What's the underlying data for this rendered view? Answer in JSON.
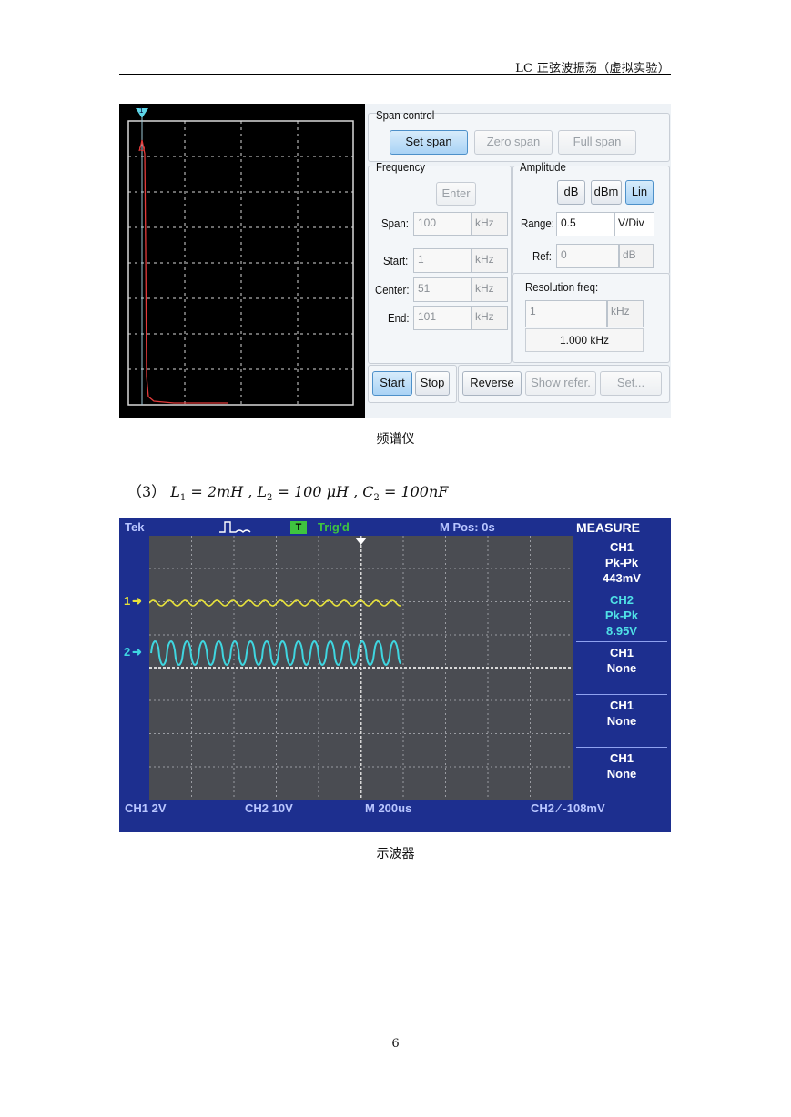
{
  "header": {
    "title": "LC 正弦波振荡（虚拟实验）"
  },
  "spectrum": {
    "marker_label": "1",
    "span_control": {
      "title": "Span control",
      "set_span": "Set span",
      "zero_span": "Zero span",
      "full_span": "Full span"
    },
    "frequency": {
      "title": "Frequency",
      "enter": "Enter",
      "span_label": "Span:",
      "span_value": "100",
      "span_unit": "kHz",
      "start_label": "Start:",
      "start_value": "1",
      "start_unit": "kHz",
      "center_label": "Center:",
      "center_value": "51",
      "center_unit": "kHz",
      "end_label": "End:",
      "end_value": "101",
      "end_unit": "kHz"
    },
    "amplitude": {
      "title": "Amplitude",
      "db": "dB",
      "dbm": "dBm",
      "lin": "Lin",
      "range_label": "Range:",
      "range_value": "0.5",
      "range_unit": "V/Div",
      "ref_label": "Ref:",
      "ref_value": "0",
      "ref_unit": "dB"
    },
    "resolution": {
      "title": "Resolution freq:",
      "value": "1",
      "unit": "kHz",
      "readout": "1.000 kHz"
    },
    "buttons": {
      "start": "Start",
      "stop": "Stop",
      "reverse": "Reverse",
      "show_refer": "Show refer.",
      "set": "Set..."
    },
    "caption": "频谱仪"
  },
  "equation": {
    "prefix": "（3）",
    "L1": "L",
    "L1_sub": "1",
    "L1_val": " = 2mH , ",
    "L2": "L",
    "L2_sub": "2",
    "L2_val": " = 100 μH , ",
    "C2": "C",
    "C2_sub": "2",
    "C2_val": " = 100nF"
  },
  "scope": {
    "brand": "Tek",
    "trig_badge": "T",
    "trig_status": "Trig'd",
    "mpos": "M Pos: 0s",
    "measure_title": "MEASURE",
    "measures": [
      {
        "ch": "CH1",
        "type": "Pk-Pk",
        "value": "443mV",
        "color": "#ffffff"
      },
      {
        "ch": "CH2",
        "type": "Pk-Pk",
        "value": "8.95V",
        "color": "#4fe0e6"
      },
      {
        "ch": "CH1",
        "type": "None",
        "value": "",
        "color": "#ffffff"
      },
      {
        "ch": "CH1",
        "type": "None",
        "value": "",
        "color": "#ffffff"
      },
      {
        "ch": "CH1",
        "type": "None",
        "value": "",
        "color": "#ffffff"
      }
    ],
    "ch1_marker": "1",
    "ch2_marker": "2",
    "ch1_scale": "CH1  2V",
    "ch2_scale": "CH2  10V",
    "timebase": "M 200us",
    "trigger": "CH2 ∕ -108mV",
    "ch1_color": "#e8e23a",
    "ch2_color": "#3fd6e0",
    "caption": "示波器"
  },
  "page_number": "6"
}
